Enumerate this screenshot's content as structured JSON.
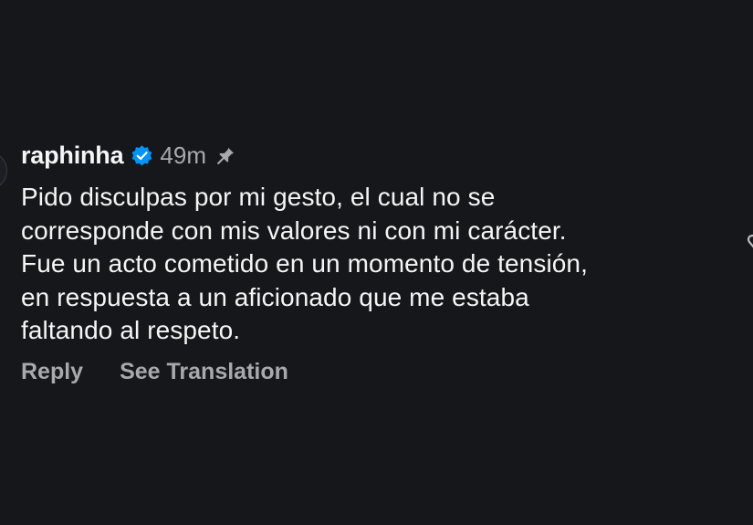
{
  "comment": {
    "username": "raphinha",
    "timestamp": "49m",
    "verified": true,
    "pinned": true,
    "body_lines": [
      "Pido disculpas por mi gesto, el cual no se",
      "corresponde con mis valores ni con mi carácter.",
      "Fue un acto cometido en un momento de tensión,",
      "en respuesta a un aficionado que me estaba",
      "faltando al respeto."
    ],
    "actions": {
      "reply": "Reply",
      "translate": "See Translation"
    }
  },
  "icons": {
    "verified": "verified-badge-icon",
    "pin": "pin-icon",
    "like": "heart-icon"
  },
  "colors": {
    "background": "#16171b",
    "text_primary": "#f5f5f5",
    "text_secondary": "#a8a8ad",
    "verified_blue": "#0095f6"
  }
}
